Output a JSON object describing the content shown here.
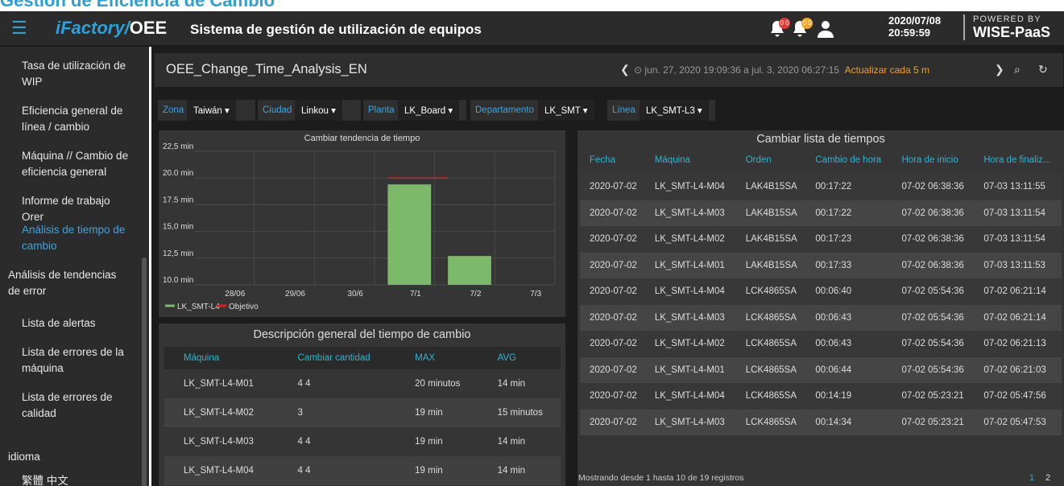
{
  "page_title": "Gestión de Eficiencia de Cambio",
  "topbar": {
    "logo_main": "iFactory/",
    "logo_oee": "OEE",
    "system_title": "Sistema de gestión de utilización de equipos",
    "notif1_count": "0 0",
    "notif2_count": "0 0",
    "date": "2020/07/08",
    "time": "20:59:59",
    "powered_by": "POWERED BY",
    "brand": "WISE-PaaS"
  },
  "sidebar": {
    "items": [
      {
        "label": "Tasa de utilización de WIP"
      },
      {
        "label": "Eficiencia general de línea / cambio"
      },
      {
        "label": "Máquina // Cambio de eficiencia general"
      },
      {
        "label": "Informe de trabajo Orer"
      },
      {
        "label": "Análisis de tiempo de cambio"
      },
      {
        "label": "Análisis de tendencias de error"
      },
      {
        "label": "Lista de alertas"
      },
      {
        "label": "Lista de errores de la máquina"
      },
      {
        "label": "Lista de errores de calidad"
      }
    ],
    "language_label": "idioma",
    "language_value": "繁體 中文"
  },
  "header": {
    "dashboard_title": "OEE_Change_Time_Analysis_EN",
    "time_range": "jun. 27, 2020 19:09:36 a jul. 3, 2020 06:27:15",
    "refresh": "Actualizar cada 5 m"
  },
  "filters": [
    {
      "label": "Zona",
      "value": "Taiwán"
    },
    {
      "label": "Ciudad",
      "value": "Linkou"
    },
    {
      "label": "Planta",
      "value": "LK_Board"
    },
    {
      "label": "Departamento",
      "value": "LK_SMT"
    },
    {
      "label": "Línea",
      "value": "LK_SMT-L3"
    }
  ],
  "chart_data": {
    "type": "bar",
    "title": "Cambiar tendencia de tiempo",
    "categories": [
      "28/06",
      "29/06",
      "30/6",
      "7/1",
      "7/2",
      "7/3"
    ],
    "y_tick_labels": [
      "22,5 min",
      "20.0 min",
      "17.5 min",
      "15,0 min",
      "12,5 min",
      "10.0 min"
    ],
    "series": [
      {
        "name": "LK_SMT-L4",
        "values": [
          null,
          null,
          null,
          19.4,
          12.7,
          null
        ],
        "color": "#7cb96b"
      },
      {
        "name": "Objetivo",
        "type": "target",
        "values": [
          null,
          null,
          null,
          20.0,
          null,
          null
        ],
        "color": "#e02020"
      }
    ],
    "ylim": [
      10,
      22.5
    ],
    "grid": true,
    "legend": "bottom-left"
  },
  "summary": {
    "title": "Descripción general del tiempo de cambio",
    "columns": [
      "Máquina",
      "Cambiar cantidad",
      "MAX",
      "AVG"
    ],
    "rows": [
      [
        "LK_SMT-L4-M01",
        "4 4",
        "20 minutos",
        "14 min"
      ],
      [
        "LK_SMT-L4-M02",
        "3",
        "19 min",
        "15 minutos"
      ],
      [
        "LK_SMT-L4-M03",
        "4 4",
        "19 min",
        "14 min"
      ],
      [
        "LK_SMT-L4-M04",
        "4 4",
        "19 min",
        "14 min"
      ]
    ]
  },
  "list": {
    "title": "Cambiar lista de tiempos",
    "columns": [
      "Fecha",
      "Máquina",
      "Orden",
      "Cambio de hora",
      "Hora de inicio",
      "Hora de finaliz..."
    ],
    "rows": [
      [
        "2020-07-02",
        "LK_SMT-L4-M04",
        "LAK4B15SA",
        "00:17:22",
        "07-02 06:38:36",
        "07-03 13:11:55"
      ],
      [
        "2020-07-02",
        "LK_SMT-L4-M03",
        "LAK4B15SA",
        "00:17:22",
        "07-02 06:38:36",
        "07-03 13:11:54"
      ],
      [
        "2020-07-02",
        "LK_SMT-L4-M02",
        "LAK4B15SA",
        "00:17:23",
        "07-02 06:38:36",
        "07-03 13:11:54"
      ],
      [
        "2020-07-02",
        "LK_SMT-L4-M01",
        "LAK4B15SA",
        "00:17:33",
        "07-02 06:38:36",
        "07-03 13:11:53"
      ],
      [
        "2020-07-02",
        "LK_SMT-L4-M04",
        "LCK4865SA",
        "00:06:40",
        "07-02 05:54:36",
        "07-02 06:21:14"
      ],
      [
        "2020-07-02",
        "LK_SMT-L4-M03",
        "LCK4865SA",
        "00:06:43",
        "07-02 05:54:36",
        "07-02 06:21:14"
      ],
      [
        "2020-07-02",
        "LK_SMT-L4-M02",
        "LCK4865SA",
        "00:06:43",
        "07-02 05:54:36",
        "07-02 06:21:13"
      ],
      [
        "2020-07-02",
        "LK_SMT-L4-M01",
        "LCK4865SA",
        "00:06:44",
        "07-02 05:54:36",
        "07-02 06:21:03"
      ],
      [
        "2020-07-02",
        "LK_SMT-L4-M04",
        "LCK4865SA",
        "00:14:19",
        "07-02 05:23:21",
        "07-02 05:47:56"
      ],
      [
        "2020-07-02",
        "LK_SMT-L4-M03",
        "LCK4865SA",
        "00:14:34",
        "07-02 05:23:21",
        "07-02 05:47:53"
      ]
    ],
    "footer": "Mostrando desde 1 hasta 10 de 19 registros",
    "pages": [
      "1",
      "2"
    ]
  },
  "colors": {
    "accent": "#2aa3dc",
    "bar": "#7cb96b",
    "target": "#e02020",
    "refresh": "#f0a020"
  }
}
